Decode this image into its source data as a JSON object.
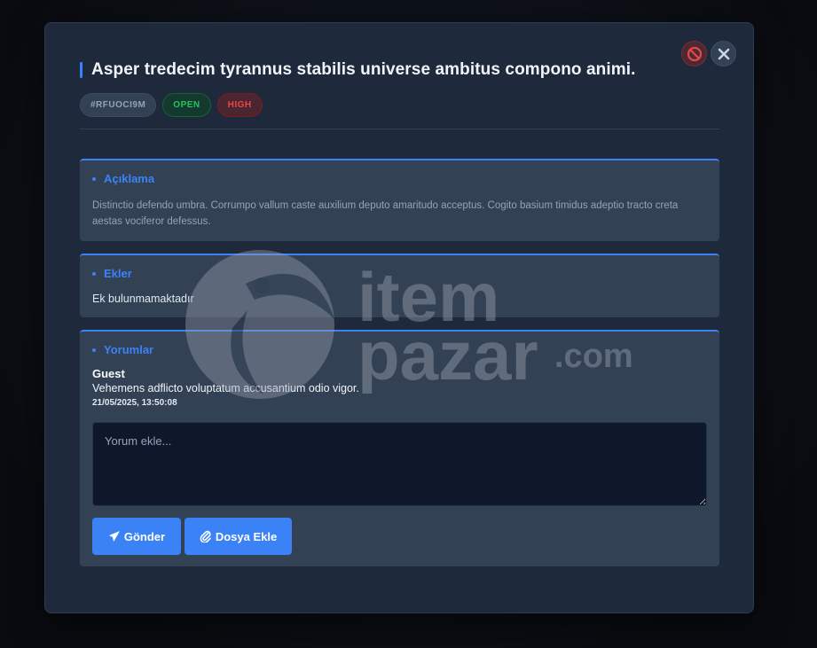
{
  "ticket": {
    "title": "Asper tredecim tyrannus stabilis universe ambitus compono animi.",
    "id_badge": "#RFUOCI9M",
    "status_badge": "OPEN",
    "priority_badge": "HIGH"
  },
  "header_actions": {
    "block_icon": "block-icon",
    "close_icon": "close-icon"
  },
  "description": {
    "title": "Açıklama",
    "text": "Distinctio defendo umbra. Corrumpo vallum caste auxilium deputo amaritudo acceptus. Cogito basium timidus adeptio tracto creta aestas vociferor defessus."
  },
  "attachments": {
    "title": "Ekler",
    "empty_text": "Ek bulunmamaktadır"
  },
  "comments": {
    "title": "Yorumlar",
    "items": [
      {
        "author": "Guest",
        "body": "Vehemens adflicto voluptatum accusantium odio vigor.",
        "timestamp": "21/05/2025, 13:50:08"
      }
    ],
    "input_placeholder": "Yorum ekle...",
    "send_label": "Gönder",
    "attach_label": "Dosya Ekle"
  },
  "watermark": {
    "line1": "item",
    "line2": "pazar",
    "suffix": ".com"
  },
  "colors": {
    "accent": "#3b82f6",
    "open": "#22c55e",
    "high": "#ef4444",
    "modal_bg": "#1e293b",
    "card_bg": "#334155"
  }
}
